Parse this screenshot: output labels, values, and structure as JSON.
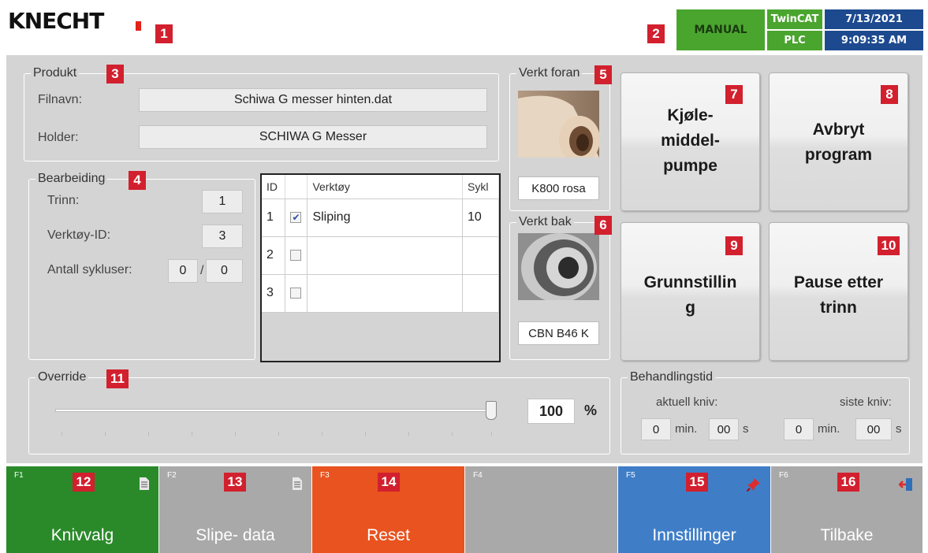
{
  "header": {
    "logo_text": "KNECHT",
    "mode": "MANUAL",
    "system": "TwinCAT",
    "controller": "PLC",
    "date": "7/13/2021",
    "time": "9:09:35 AM",
    "colors": {
      "green": "#4aa52e",
      "blue": "#1d4a8f",
      "logo_red": "#e2231a"
    }
  },
  "markers": [
    "1",
    "2",
    "3",
    "4",
    "5",
    "6",
    "7",
    "8",
    "9",
    "10",
    "11",
    "12",
    "13",
    "14",
    "15",
    "16"
  ],
  "produkt": {
    "title": "Produkt",
    "filnavn_label": "Filnavn:",
    "filnavn_value": "Schiwa G messer hinten.dat",
    "holder_label": "Holder:",
    "holder_value": "SCHIWA G Messer"
  },
  "bearbeiding": {
    "title": "Bearbeiding",
    "trinn_label": "Trinn:",
    "trinn_value": "1",
    "verktoy_id_label": "Verktøy-ID:",
    "verktoy_id_value": "3",
    "antall_label": "Antall sykluser:",
    "antall_current": "0",
    "separator": "/",
    "antall_total": "0"
  },
  "tool_table": {
    "headers": [
      "ID",
      "",
      "Verktøy",
      "Sykl"
    ],
    "rows": [
      {
        "id": "1",
        "checked": true,
        "tool": "Sliping",
        "sykl": "10"
      },
      {
        "id": "2",
        "checked": false,
        "tool": "",
        "sykl": ""
      },
      {
        "id": "3",
        "checked": false,
        "tool": "",
        "sykl": ""
      }
    ]
  },
  "verkt_foran": {
    "title": "Verkt foran",
    "label": "K800 rosa",
    "image": "sanding-roll-image"
  },
  "verkt_bak": {
    "title": "Verkt bak",
    "label": "CBN B46 K",
    "image": "grinding-wheel-image"
  },
  "buttons": {
    "pump": [
      "Kjøle-",
      "middel-",
      "pumpe"
    ],
    "abort": [
      "Avbryt",
      "program"
    ],
    "home": [
      "Grunnstillin",
      "g"
    ],
    "pause": [
      "Pause etter",
      "trinn"
    ]
  },
  "override": {
    "title": "Override",
    "value": "100",
    "unit": "%",
    "level_percent": 100
  },
  "behandlingstid": {
    "title": "Behandlingstid",
    "current_label": "aktuell kniv:",
    "last_label": "siste kniv:",
    "current_min": "0",
    "current_sec": "00",
    "last_min": "0",
    "last_sec": "00",
    "min_unit": "min.",
    "sec_unit": "s"
  },
  "footer": [
    {
      "key": "F1",
      "label": "Knivvalg",
      "color": "#2a8a2a",
      "icon": "document-icon"
    },
    {
      "key": "F2",
      "label": "Slipe- data",
      "color": "#a9a9a9",
      "icon": "document-icon"
    },
    {
      "key": "F3",
      "label": "Reset",
      "color": "#e8531f",
      "icon": ""
    },
    {
      "key": "F4",
      "label": "",
      "color": "#a9a9a9",
      "icon": ""
    },
    {
      "key": "F5",
      "label": "Innstillinger",
      "color": "#3f7ec7",
      "icon": "pin-icon"
    },
    {
      "key": "F6",
      "label": "Tilbake",
      "color": "#a9a9a9",
      "icon": "exit-door-icon"
    }
  ]
}
